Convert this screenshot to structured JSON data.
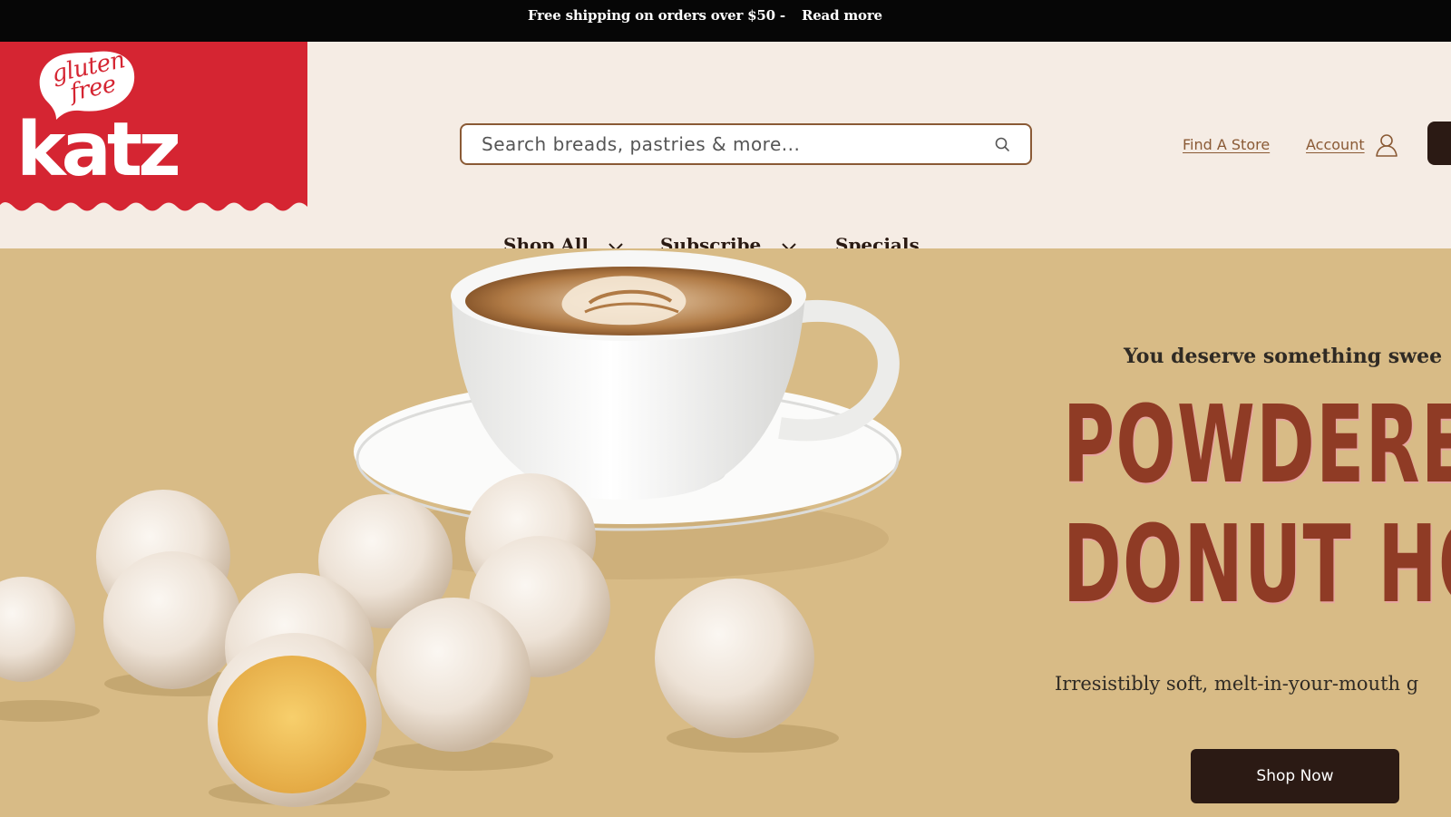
{
  "announcement": {
    "text": "Free shipping on orders over $50 -",
    "link": "Read more"
  },
  "brand": {
    "bubble_text": "gluten free",
    "wordmark": "katz",
    "red": "#d52532"
  },
  "search": {
    "placeholder": "Search breads, pastries & more...",
    "value": ""
  },
  "header_links": {
    "find_store": "Find A Store",
    "account": "Account"
  },
  "nav": {
    "items": [
      {
        "label": "Shop All",
        "has_dropdown": true
      },
      {
        "label": "Subscribe",
        "has_dropdown": true
      },
      {
        "label": "Specials",
        "has_dropdown": false
      }
    ]
  },
  "hero": {
    "subtitle": "You deserve something swee",
    "title_line1": "POWDERED",
    "title_line2": "DONUT HOL",
    "description": "Irresistibly soft, melt-in-your-mouth g",
    "cta": "Shop Now",
    "background": "#d8bb86",
    "title_color": "#8f3b25"
  },
  "colors": {
    "topbar": "#060606",
    "header_bg": "#f5ece4",
    "accent_brown": "#8a5a35",
    "button_dark": "#2b1a14"
  }
}
